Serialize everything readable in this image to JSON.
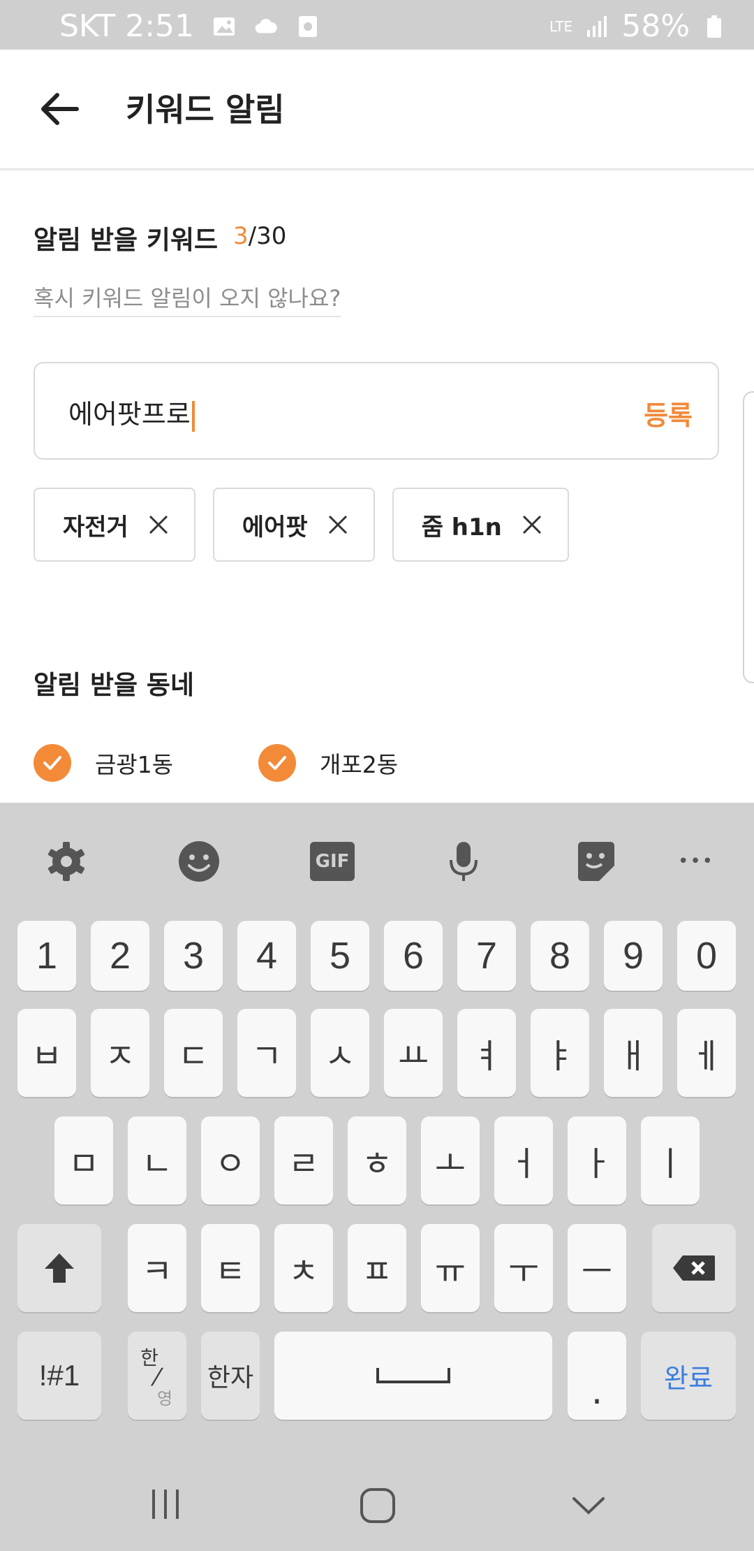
{
  "status_bar": {
    "carrier_time": "SKT 2:51",
    "network": "LTE",
    "battery": "58%",
    "icons": [
      "image-icon",
      "cloud-icon",
      "record-icon",
      "signal-icon",
      "battery-icon"
    ]
  },
  "header": {
    "title": "키워드 알림",
    "back_icon": "arrow-left-icon"
  },
  "keywords": {
    "section_title": "알림 받을 키워드",
    "count_current": "3",
    "count_total": "/30",
    "help_link": "혹시 키워드 알림이 오지 않나요?",
    "input_value": "에어팟프로",
    "register_label": "등록",
    "chips": [
      {
        "label": "자전거",
        "remove_icon": "close-icon"
      },
      {
        "label": "에어팟",
        "remove_icon": "close-icon"
      },
      {
        "label": "줌 h1n",
        "remove_icon": "close-icon"
      }
    ]
  },
  "towns": {
    "section_title": "알림 받을 동네",
    "items": [
      {
        "label": "금광1동",
        "checked": true
      },
      {
        "label": "개포2동",
        "checked": true
      }
    ]
  },
  "keyboard": {
    "toolbar": [
      "gear-icon",
      "emoji-icon",
      "gif-icon",
      "mic-icon",
      "sticker-icon",
      "more-icon"
    ],
    "gif_label": "GIF",
    "more_label": "•••",
    "row1": [
      "1",
      "2",
      "3",
      "4",
      "5",
      "6",
      "7",
      "8",
      "9",
      "0"
    ],
    "row2": [
      "ㅂ",
      "ㅈ",
      "ㄷ",
      "ㄱ",
      "ㅅ",
      "ㅛ",
      "ㅕ",
      "ㅑ",
      "ㅐ",
      "ㅔ"
    ],
    "row3": [
      "ㅁ",
      "ㄴ",
      "ㅇ",
      "ㄹ",
      "ㅎ",
      "ㅗ",
      "ㅓ",
      "ㅏ",
      "ㅣ"
    ],
    "row4": [
      "ㅋ",
      "ㅌ",
      "ㅊ",
      "ㅍ",
      "ㅠ",
      "ㅜ",
      "ㅡ"
    ],
    "symbols_label": "!#1",
    "lang_top": "한",
    "lang_bottom": "영",
    "hanja_label": "한자",
    "period_label": ".",
    "done_label": "완료",
    "accent": "#3b7ee0"
  },
  "colors": {
    "accent": "#f08a3a",
    "keyboard_bg": "#d1d1d1"
  }
}
